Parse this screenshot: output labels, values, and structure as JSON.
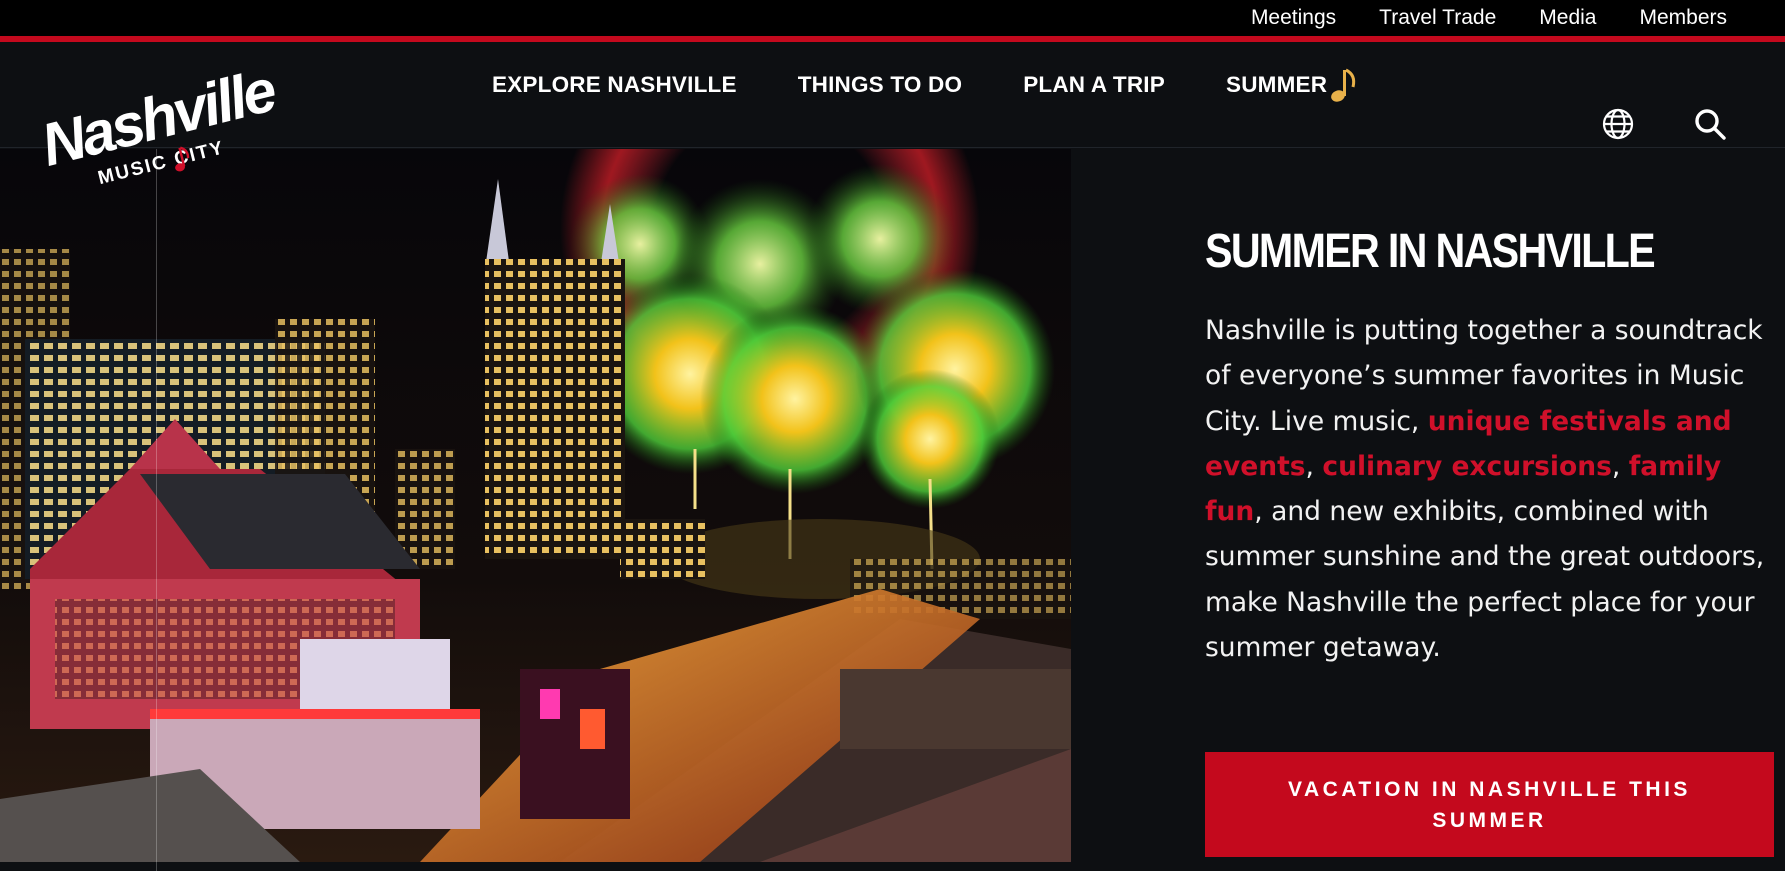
{
  "utility_nav": {
    "items": [
      "Meetings",
      "Travel Trade",
      "Media",
      "Members"
    ]
  },
  "logo": {
    "line1": "Nashville",
    "line2": "MUSIC CITY"
  },
  "main_nav": {
    "items": [
      {
        "label": "EXPLORE NASHVILLE"
      },
      {
        "label": "THINGS TO DO"
      },
      {
        "label": "PLAN A TRIP"
      },
      {
        "label": "SUMMER",
        "icon": "music-note-icon"
      }
    ]
  },
  "header_icons": [
    "globe-icon",
    "search-icon"
  ],
  "hero": {
    "image_alt": "Nashville skyline at night with fireworks over Broadway",
    "title": "SUMMER IN NASHVILLE",
    "body": {
      "text1": "Nashville is putting together a soundtrack of everyone’s summer favorites in Music City. Live music, ",
      "link1": "unique festivals and events",
      "sep1": ", ",
      "link2": "culinary excursions",
      "sep2": ", ",
      "link3": "family fun",
      "text2": ", and new exhibits, combined with summer sunshine and the great outdoors, make Nashville the perfect place for your summer getaway."
    },
    "cta_label": "VACATION IN NASHVILLE THIS SUMMER"
  },
  "colors": {
    "brand_red": "#c4091d",
    "link_red": "#d0102a",
    "background": "#0d0f12",
    "accent_gold": "#e8b14a"
  }
}
